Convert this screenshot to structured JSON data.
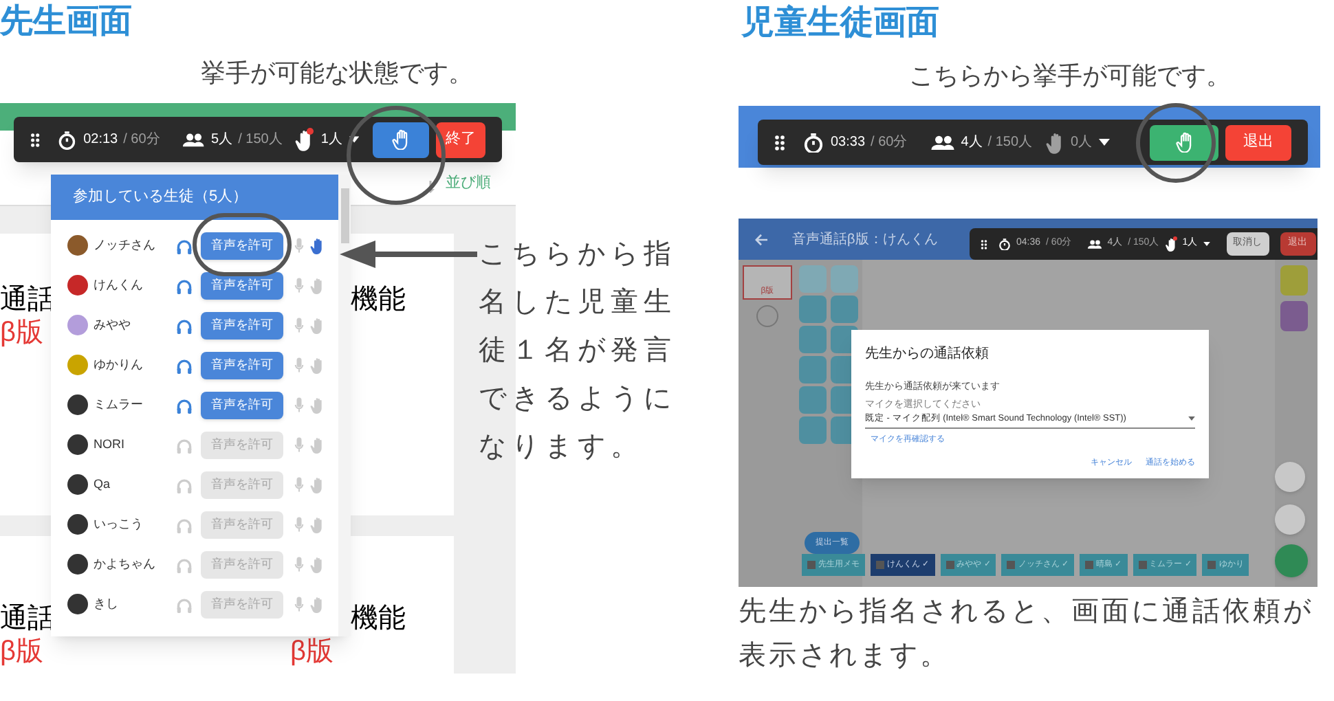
{
  "teacher": {
    "title": "先生画面",
    "caption": "挙手が可能な状態です。",
    "toolbar": {
      "kind": "teacher",
      "elapsed": "02:13",
      "limit": "/ 60分",
      "participants": "5人",
      "capacity": "/ 150人",
      "hands": "1人",
      "hand_alert": true,
      "end_button": "終了"
    },
    "sort_label": "並び順",
    "cards": [
      {
        "left": "通話",
        "left_sub": "β版",
        "right": "機能"
      },
      {
        "left": "通話",
        "left_sub": "β版",
        "right": "機能",
        "right_sub": "β版"
      }
    ],
    "panel": {
      "title": "参加している生徒（5人）",
      "students": [
        {
          "name": "ノッチさん",
          "color": "#8b5a2b",
          "connected": true,
          "allow_button": "音声を許可",
          "hand_raised": true
        },
        {
          "name": "けんくん",
          "color": "#c62828",
          "connected": true,
          "allow_button": "音声を許可",
          "hand_raised": false
        },
        {
          "name": "みやや",
          "color": "#b39ddb",
          "connected": true,
          "allow_button": "音声を許可",
          "hand_raised": false
        },
        {
          "name": "ゆかりん",
          "color": "#c9a400",
          "connected": true,
          "allow_button": "音声を許可",
          "hand_raised": false
        },
        {
          "name": "ミムラー",
          "color": "#333333",
          "connected": true,
          "allow_button": "音声を許可",
          "hand_raised": false
        },
        {
          "name": "NORI",
          "color": "#333333",
          "connected": false,
          "allow_button": "音声を許可",
          "hand_raised": false
        },
        {
          "name": "Qa",
          "color": "#333333",
          "connected": false,
          "allow_button": "音声を許可",
          "hand_raised": false
        },
        {
          "name": "いっこう",
          "color": "#333333",
          "connected": false,
          "allow_button": "音声を許可",
          "hand_raised": false
        },
        {
          "name": "かよちゃん",
          "color": "#333333",
          "connected": false,
          "allow_button": "音声を許可",
          "hand_raised": false
        },
        {
          "name": "きし",
          "color": "#333333",
          "connected": false,
          "allow_button": "音声を許可",
          "hand_raised": false
        }
      ]
    },
    "callout": "こちらから指名した児童生徒１名が発言できるようになります。"
  },
  "student": {
    "title": "児童生徒画面",
    "caption": "こちらから挙手が可能です。",
    "toolbar": {
      "kind": "student",
      "elapsed": "03:33",
      "limit": "/ 60分",
      "participants": "4人",
      "capacity": "/ 150人",
      "hands": "0人",
      "hand_alert": false,
      "end_button": "退出"
    },
    "app": {
      "header_title": "音声通話β版：けんくん",
      "toolbar": {
        "elapsed": "04:36",
        "limit": "/ 60分",
        "participants": "4人",
        "capacity": "/ 150人",
        "hands": "1人",
        "hand_alert": true,
        "cancel_button": "取消し",
        "end_button": "退出"
      },
      "slide_thumbnail": "β版",
      "dialog": {
        "title": "先生からの通話依頼",
        "message": "先生から通話依頼が来ています",
        "mic_label": "マイクを選択してください",
        "mic_value": "既定 - マイク配列 (Intel® Smart Sound Technology (Intel® SST))",
        "recheck_link": "マイクを再確認する",
        "cancel": "キャンセル",
        "start": "通話を始める"
      },
      "list_button": "提出一覧",
      "tabs": [
        {
          "label": "先生用メモ",
          "selected": false
        },
        {
          "label": "けんくん ✓",
          "selected": true
        },
        {
          "label": "みやや ✓",
          "selected": false
        },
        {
          "label": "ノッチさん ✓",
          "selected": false
        },
        {
          "label": "晴島 ✓",
          "selected": false
        },
        {
          "label": "ミムラー ✓",
          "selected": false
        },
        {
          "label": "ゆかり",
          "selected": false
        }
      ]
    },
    "footer": "先生から指名されると、画面に通話依頼が表示されます。"
  }
}
